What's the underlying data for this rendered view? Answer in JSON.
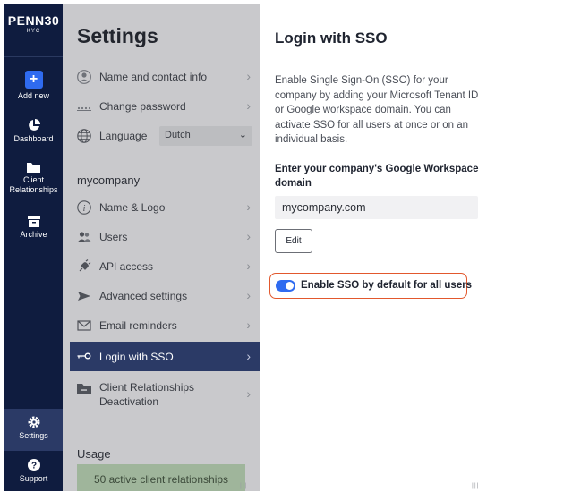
{
  "nav": {
    "logo_main": "PENN30",
    "logo_sub": "KYC",
    "items": [
      {
        "label": "Add new",
        "icon": "plus-icon"
      },
      {
        "label": "Dashboard",
        "icon": "pie-chart-icon"
      },
      {
        "label": "Client Relationships",
        "icon": "folder-icon"
      },
      {
        "label": "Archive",
        "icon": "archive-icon"
      }
    ],
    "bottom": [
      {
        "label": "Settings",
        "icon": "gear-icon"
      },
      {
        "label": "Support",
        "icon": "help-icon"
      }
    ]
  },
  "settings": {
    "title": "Settings",
    "personal": [
      {
        "label": "Name and contact info",
        "icon": "person-icon"
      },
      {
        "label": "Change password",
        "icon": "password-icon"
      },
      {
        "label": "Language",
        "icon": "globe-icon"
      }
    ],
    "language_value": "Dutch",
    "company_heading": "mycompany",
    "company": [
      {
        "label": "Name & Logo",
        "icon": "info-icon"
      },
      {
        "label": "Users",
        "icon": "users-icon"
      },
      {
        "label": "API access",
        "icon": "plug-icon"
      },
      {
        "label": "Advanced settings",
        "icon": "send-icon"
      },
      {
        "label": "Email reminders",
        "icon": "mail-icon"
      },
      {
        "label": "Login with SSO",
        "icon": "key-icon"
      },
      {
        "label": "Client Relationships\nDeactivation",
        "icon": "folder-minus-icon"
      }
    ],
    "usage_heading": "Usage",
    "usage_text": "50 active client relationships"
  },
  "sso": {
    "title": "Login with SSO",
    "description": "Enable Single Sign-On (SSO) for your company by adding your Microsoft Tenant ID or Google workspace domain. You can activate SSO for all users at once or on an individual basis.",
    "domain_label": "Enter your company's Google Workspace domain",
    "domain_value": "mycompany.com",
    "edit_label": "Edit",
    "toggle_label": "Enable SSO by default for all users",
    "toggle_on": true
  },
  "colors": {
    "nav_bg": "#0f1c3f",
    "active_bg": "#2b3a66",
    "accent": "#2f6bf0",
    "highlight": "#e2582d"
  }
}
